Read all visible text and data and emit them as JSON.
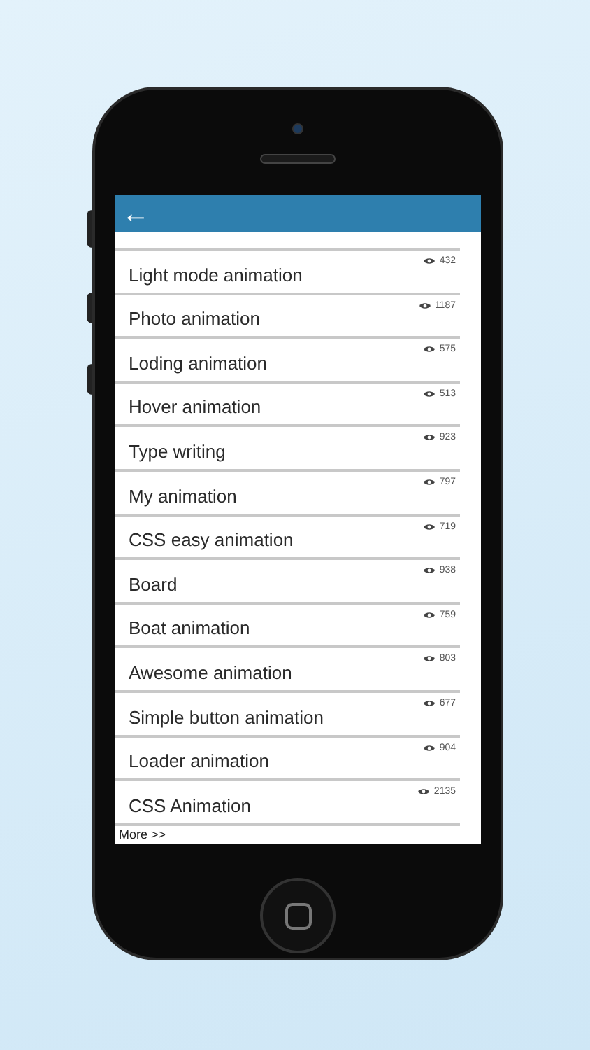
{
  "header": {
    "back_button": "←"
  },
  "items": [
    {
      "title": "Light mode animation",
      "views": "432"
    },
    {
      "title": "Photo animation",
      "views": "1187"
    },
    {
      "title": "Loding animation",
      "views": "575"
    },
    {
      "title": "Hover animation",
      "views": "513"
    },
    {
      "title": "Type writing",
      "views": "923"
    },
    {
      "title": "My animation",
      "views": "797"
    },
    {
      "title": "CSS easy animation",
      "views": "719"
    },
    {
      "title": "Board",
      "views": "938"
    },
    {
      "title": "Boat animation",
      "views": "759"
    },
    {
      "title": "Awesome animation",
      "views": "803"
    },
    {
      "title": "Simple button animation",
      "views": "677"
    },
    {
      "title": "Loader animation",
      "views": "904"
    },
    {
      "title": "CSS Animation",
      "views": "2135"
    }
  ],
  "more_link": "More >>"
}
